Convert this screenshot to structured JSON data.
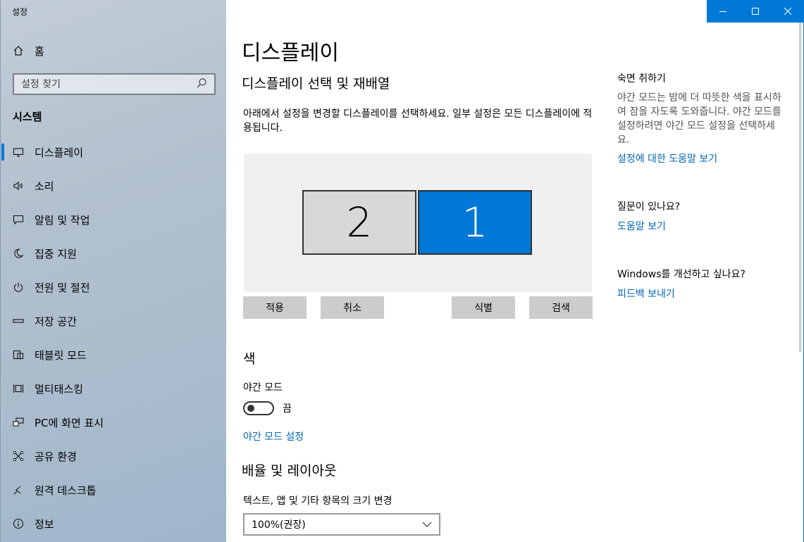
{
  "app": {
    "title": "설정"
  },
  "sidebar": {
    "home_label": "홈",
    "search_placeholder": "설정 찾기",
    "section_title": "시스템",
    "items": [
      {
        "label": "디스플레이",
        "icon": "display-icon",
        "active": true
      },
      {
        "label": "소리",
        "icon": "speaker-icon"
      },
      {
        "label": "알림 및 작업",
        "icon": "notification-icon"
      },
      {
        "label": "집중 지원",
        "icon": "moon-icon"
      },
      {
        "label": "전원 및 절전",
        "icon": "power-icon"
      },
      {
        "label": "저장 공간",
        "icon": "storage-icon"
      },
      {
        "label": "태블릿 모드",
        "icon": "tablet-icon"
      },
      {
        "label": "멀티태스킹",
        "icon": "multitasking-icon"
      },
      {
        "label": "PC에 화면 표시",
        "icon": "project-icon"
      },
      {
        "label": "공유 환경",
        "icon": "share-icon"
      },
      {
        "label": "원격 데스크톱",
        "icon": "remote-desktop-icon"
      },
      {
        "label": "정보",
        "icon": "info-icon"
      }
    ]
  },
  "main": {
    "title": "디스플레이",
    "arrange_title": "디스플레이 선택 및 재배열",
    "arrange_desc": "아래에서 설정을 변경할 디스플레이를 선택하세요. 일부 설정은 모든 디스플레이에 적용됩니다.",
    "monitors": [
      {
        "number": "2",
        "selected": false
      },
      {
        "number": "1",
        "selected": true
      }
    ],
    "buttons": {
      "apply": "적용",
      "cancel": "취소",
      "identify": "식별",
      "detect": "검색"
    },
    "color_title": "색",
    "night_light_label": "야간 모드",
    "night_light_state": "끔",
    "night_light_link": "야간 모드 설정",
    "scale_title": "배율 및 레이아웃",
    "scale_label": "텍스트, 앱 및 기타 항목의 크기 변경",
    "scale_value": "100%(권장)"
  },
  "right": {
    "sleep_title": "숙면 취하기",
    "sleep_desc": "야간 모드는 밤에 더 따뜻한 색을 표시하여 잠을 자도록 도와줍니다. 야간 모드를 설정하려면 야간 모드 설정을 선택하세요.",
    "sleep_link": "설정에 대한 도움말 보기",
    "question_title": "질문이 있나요?",
    "question_link": "도움말 보기",
    "improve_title": "Windows를 개선하고 싶나요?",
    "improve_link": "피드백 보내기"
  },
  "colors": {
    "accent": "#0078d7",
    "link": "#0066b4"
  }
}
